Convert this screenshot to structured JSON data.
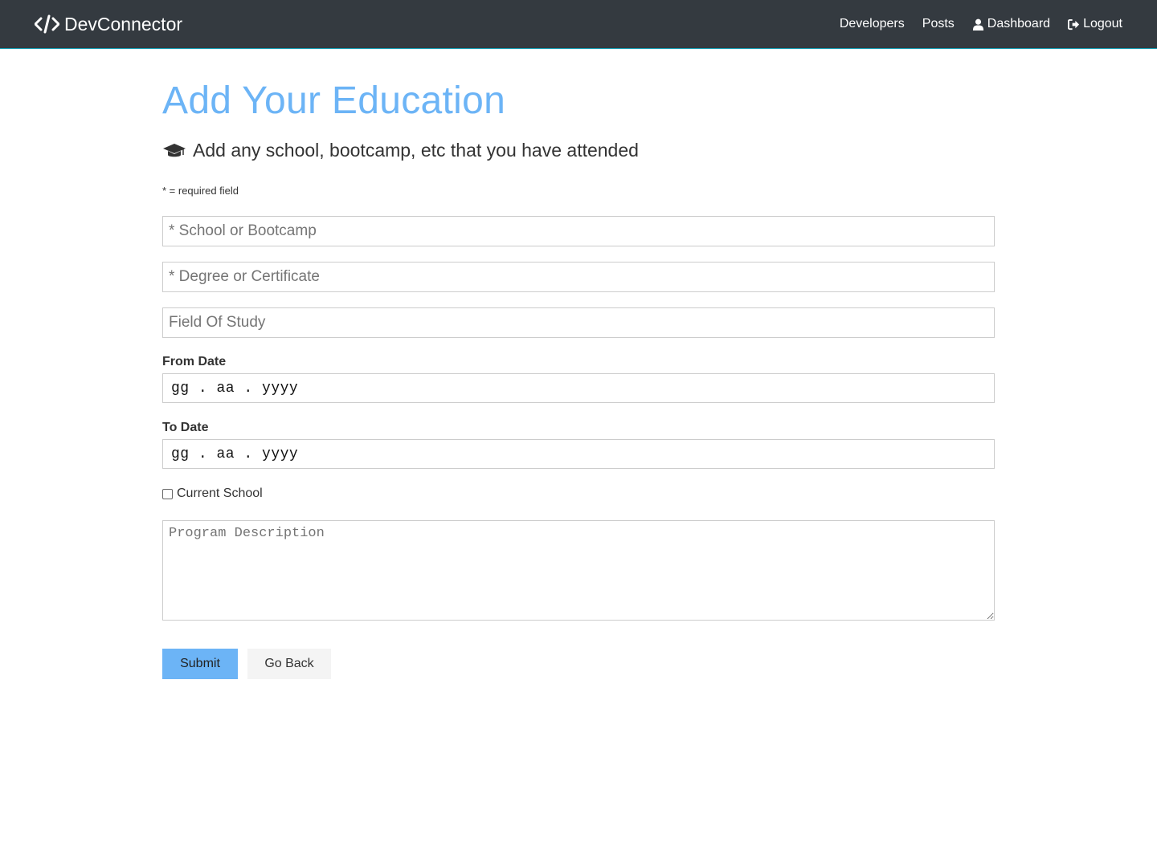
{
  "navbar": {
    "brand": "DevConnector",
    "links": {
      "developers": "Developers",
      "posts": "Posts",
      "dashboard": "Dashboard",
      "logout": "Logout"
    }
  },
  "page": {
    "title": "Add Your Education",
    "lead": "Add any school, bootcamp, etc that you have attended",
    "required_note": "* = required field"
  },
  "form": {
    "school_placeholder": "* School or Bootcamp",
    "degree_placeholder": "* Degree or Certificate",
    "fieldofstudy_placeholder": "Field Of Study",
    "from_label": "From Date",
    "from_value": "gg . aa . yyyy",
    "to_label": "To Date",
    "to_value": "gg . aa . yyyy",
    "current_label": "Current School",
    "current_checked": false,
    "description_placeholder": "Program Description",
    "submit_label": "Submit",
    "back_label": "Go Back"
  },
  "colors": {
    "navbar_bg": "#343a40",
    "primary": "#6cb4f6",
    "light": "#f4f4f4"
  }
}
